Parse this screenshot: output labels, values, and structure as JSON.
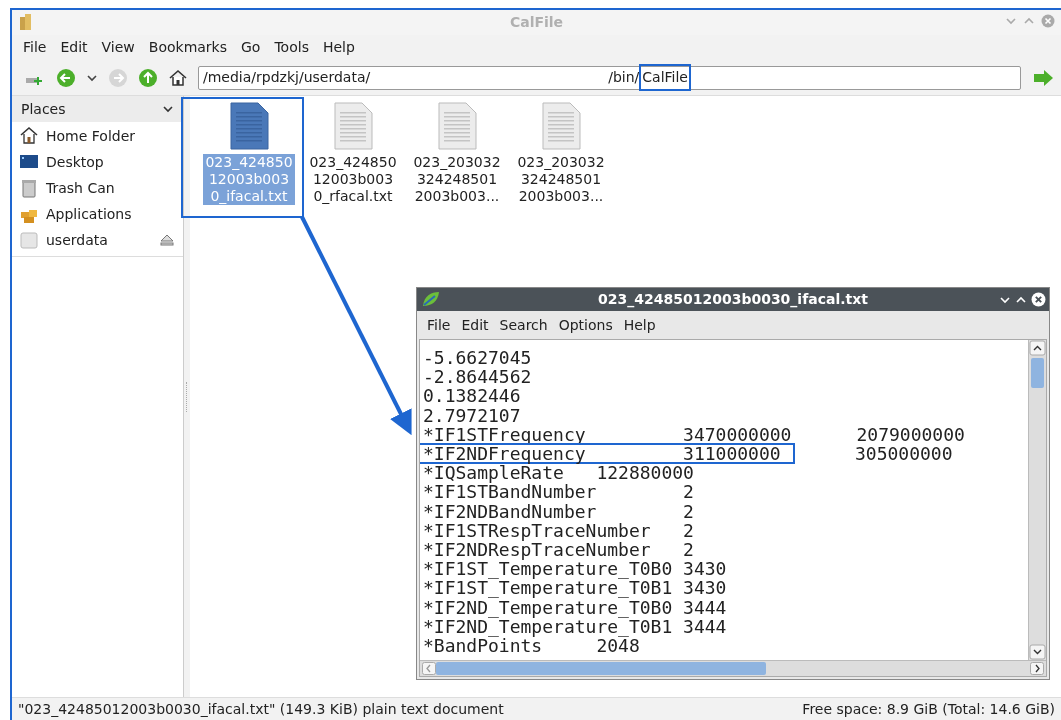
{
  "window": {
    "title": "CalFile"
  },
  "menu": [
    "File",
    "Edit",
    "View",
    "Bookmarks",
    "Go",
    "Tools",
    "Help"
  ],
  "address": {
    "segments": [
      {
        "text": "/media/rpdzkj/userdata/",
        "framed": false
      },
      {
        "text": "/bin/",
        "framed": false
      },
      {
        "text": "CalFile",
        "framed": true
      }
    ]
  },
  "sidebar": {
    "header": "Places",
    "items": [
      {
        "kind": "home",
        "label": "Home Folder"
      },
      {
        "kind": "desktop",
        "label": "Desktop"
      },
      {
        "kind": "trash",
        "label": "Trash Can"
      },
      {
        "kind": "apps",
        "label": "Applications"
      },
      {
        "kind": "drive",
        "label": "userdata"
      }
    ]
  },
  "files": [
    {
      "label_lines": [
        "023_424850",
        "12003b003",
        "0_ifacal.txt"
      ],
      "selected": true
    },
    {
      "label_lines": [
        "023_424850",
        "12003b003",
        "0_rfacal.txt"
      ],
      "selected": false
    },
    {
      "label_lines": [
        "023_203032",
        "324248501",
        "2003b003..."
      ],
      "selected": false
    },
    {
      "label_lines": [
        "023_203032",
        "324248501",
        "2003b003..."
      ],
      "selected": false
    }
  ],
  "editor": {
    "title": "023_42485012003b0030_ifacal.txt",
    "menu": [
      "File",
      "Edit",
      "Search",
      "Options",
      "Help"
    ],
    "lines": [
      {
        "text": "-5.6627045",
        "framed": false
      },
      {
        "text": "-2.8644562",
        "framed": false
      },
      {
        "text": "0.1382446",
        "framed": false
      },
      {
        "text": "2.7972107",
        "framed": false
      },
      {
        "text": "*IF1STFrequency         3470000000      2079000000",
        "framed": false
      },
      {
        "text": "*IF2NDFrequency         311000000",
        "framed": true,
        "tail": "305000000"
      },
      {
        "text": "*IQSampleRate   122880000",
        "framed": false
      },
      {
        "text": "*IF1STBandNumber        2",
        "framed": false
      },
      {
        "text": "*IF2NDBandNumber        2",
        "framed": false
      },
      {
        "text": "*IF1STRespTraceNumber   2",
        "framed": false
      },
      {
        "text": "*IF2NDRespTraceNumber   2",
        "framed": false
      },
      {
        "text": "*IF1ST_Temperature_T0B0 3430",
        "framed": false
      },
      {
        "text": "*IF1ST_Temperature_T0B1 3430",
        "framed": false
      },
      {
        "text": "*IF2ND_Temperature_T0B0 3444",
        "framed": false
      },
      {
        "text": "*IF2ND_Temperature_T0B1 3444",
        "framed": false
      },
      {
        "text": "*BandPoints     2048",
        "framed": false
      }
    ]
  },
  "status_bar": {
    "left": "\"023_42485012003b0030_ifacal.txt\" (149.3 KiB) plain text document",
    "right": "Free space: 8.9 GiB (Total: 14.6 GiB)"
  }
}
